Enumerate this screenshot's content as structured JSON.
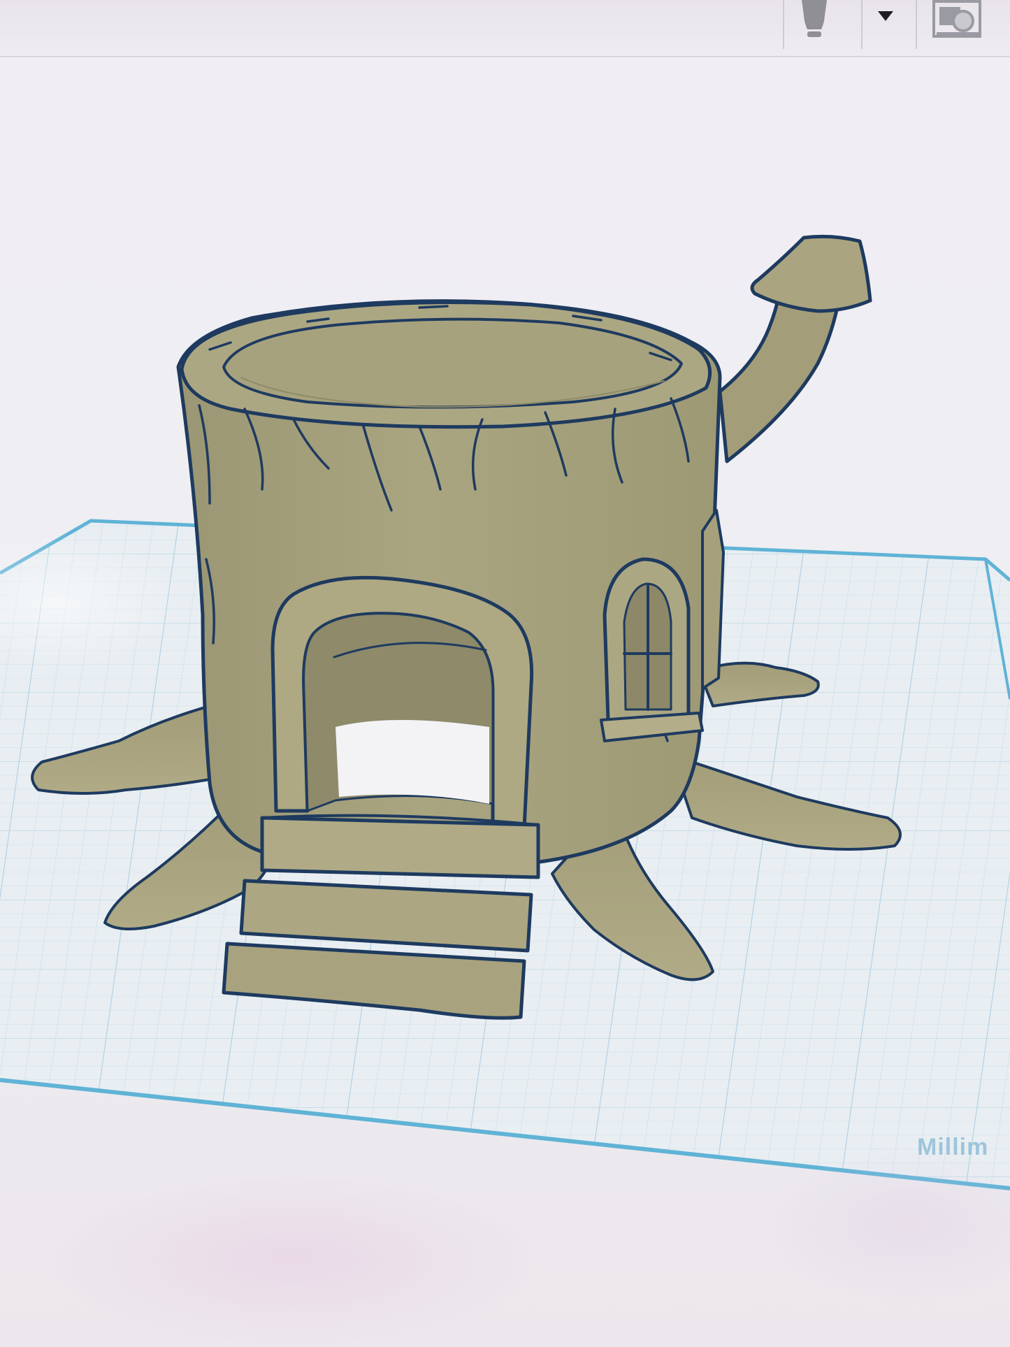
{
  "app": {
    "units_label": "Millim"
  },
  "toolbar": {
    "icons": [
      "lightbulb-icon",
      "chevron-down-icon",
      "view-cube-icon"
    ]
  },
  "scene": {
    "model_name": "",
    "model_color": "#a8a37e",
    "outline_color": "#1e3a5f",
    "grid_color": "#9fd2e6"
  }
}
